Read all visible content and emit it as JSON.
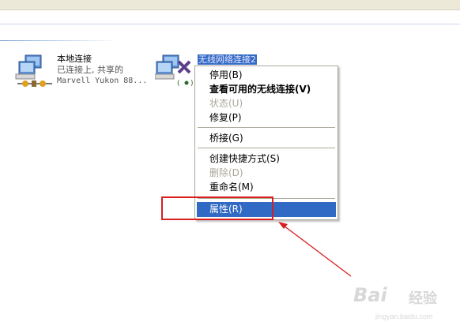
{
  "connections": [
    {
      "name": "本地连接",
      "status": "已连接上, 共享的",
      "device": "Marvell Yukon 88...",
      "icon": "lan-connection-icon"
    },
    {
      "name": "无线网络连接2",
      "icon": "wireless-connection-disabled-icon"
    }
  ],
  "context_menu": {
    "items": [
      {
        "label": "停用(B)",
        "enabled": true
      },
      {
        "label": "查看可用的无线连接(V)",
        "enabled": true,
        "bold": true
      },
      {
        "label": "状态(U)",
        "enabled": false
      },
      {
        "label": "修复(P)",
        "enabled": true
      },
      {
        "label": "桥接(G)",
        "enabled": true
      },
      {
        "label": "创建快捷方式(S)",
        "enabled": true
      },
      {
        "label": "删除(D)",
        "enabled": false
      },
      {
        "label": "重命名(M)",
        "enabled": true
      },
      {
        "label": "属性(R)",
        "enabled": true,
        "selected": true
      }
    ]
  },
  "colors": {
    "selection": "#316ac5",
    "annotation": "#d81e1e",
    "disabled_text": "#aca899"
  },
  "watermark": {
    "brand": "Bai",
    "brand2": "经验",
    "url": "jingyan.baidu.com"
  }
}
